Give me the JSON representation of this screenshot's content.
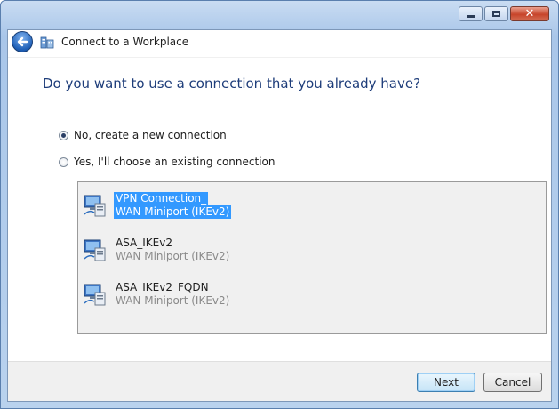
{
  "window": {
    "title": "Connect to a Workplace",
    "caption_buttons": [
      "minimize",
      "maximize",
      "close"
    ]
  },
  "heading": "Do you want to use a connection that you already have?",
  "options": [
    {
      "label": "No, create a new connection",
      "selected": true
    },
    {
      "label": "Yes, I'll choose an existing connection",
      "selected": false
    }
  ],
  "connections": [
    {
      "name": "VPN Connection_",
      "device": "WAN Miniport (IKEv2)",
      "selected": true,
      "icon": "network-connection-icon"
    },
    {
      "name": "ASA_IKEv2",
      "device": "WAN Miniport (IKEv2)",
      "selected": false,
      "icon": "network-connection-icon"
    },
    {
      "name": "ASA_IKEv2_FQDN",
      "device": "WAN Miniport (IKEv2)",
      "selected": false,
      "icon": "network-connection-icon"
    }
  ],
  "buttons": {
    "next": "Next",
    "cancel": "Cancel"
  },
  "colors": {
    "heading": "#1e3d7a",
    "selection": "#3399ff",
    "close_button": "#c7452b"
  }
}
